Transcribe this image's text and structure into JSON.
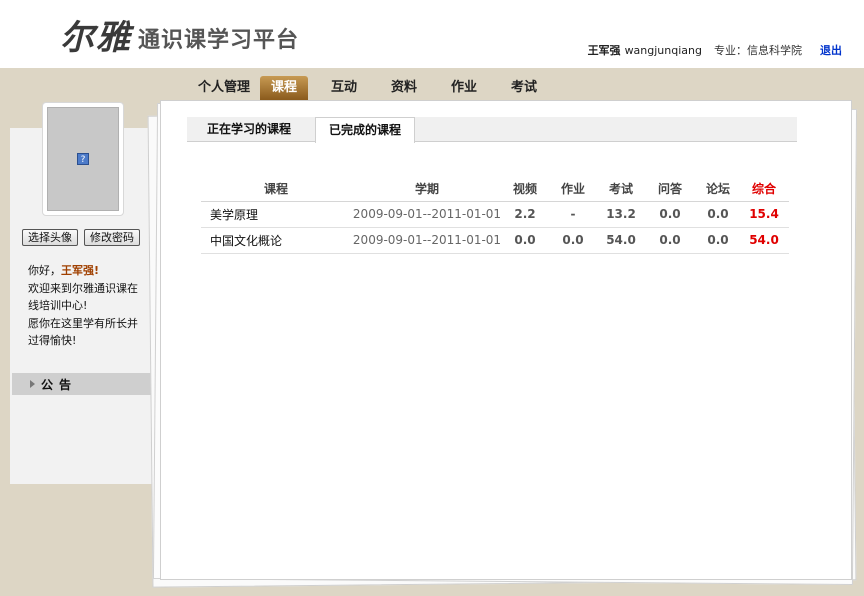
{
  "header": {
    "logo_mark": "尔雅",
    "logo_text": "通识课学习平台",
    "user_name": "王军强",
    "user_login": "wangjunqiang",
    "major_label": "专业：",
    "major_value": "信息科学院",
    "logout": "退出"
  },
  "nav": {
    "items": [
      "个人管理",
      "课程",
      "互动",
      "资料",
      "作业",
      "考试"
    ],
    "active": "课程"
  },
  "sidebar": {
    "avatar_icon": "broken-image-icon",
    "buttons": [
      "选择头像",
      "修改密码"
    ],
    "greeting_prefix": "你好，",
    "greeting_name": "王军强!",
    "welcome_lines": [
      "欢迎来到尔雅通识课在",
      "线培训中心!",
      "愿你在这里学有所长并",
      "过得愉快!"
    ],
    "notice_label": "公告"
  },
  "tabs": {
    "items": [
      "正在学习的课程",
      "已完成的课程"
    ],
    "active": "已完成的课程"
  },
  "table": {
    "headers": [
      "课程",
      "学期",
      "视频",
      "作业",
      "考试",
      "问答",
      "论坛",
      "综合"
    ],
    "rows": [
      [
        "美学原理",
        "2009-09-01--2011-01-01",
        "2.2",
        "-",
        "13.2",
        "0.0",
        "0.0",
        "15.4"
      ],
      [
        "中国文化概论",
        "2009-09-01--2011-01-01",
        "0.0",
        "0.0",
        "54.0",
        "0.0",
        "0.0",
        "54.0"
      ]
    ]
  },
  "colors": {
    "accent_tab": "#8a5a1c",
    "total_red": "#e00000",
    "logout_blue": "#0033cc"
  }
}
